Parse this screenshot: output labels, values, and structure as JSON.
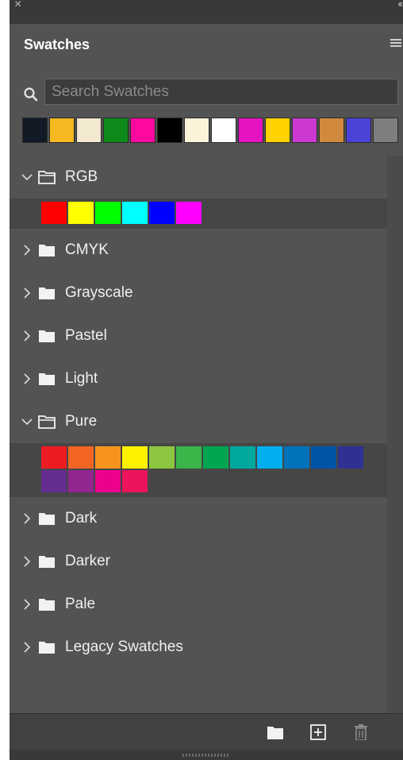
{
  "panel": {
    "tab_label": "Swatches",
    "close_icon": "close-icon",
    "collapse_icon": "collapse-icon",
    "menu_icon": "panel-menu-icon"
  },
  "search": {
    "placeholder": "Search Swatches",
    "value": ""
  },
  "recent_swatches": [
    "#121a25",
    "#f5b820",
    "#f3e8d0",
    "#0e8a1a",
    "#ff0aa0",
    "#000000",
    "#fbf3d9",
    "#ffffff",
    "#e513c1",
    "#ffd200",
    "#cc3ad3",
    "#d18a3d",
    "#4a43d8",
    "#7e7e7e"
  ],
  "groups": [
    {
      "name": "RGB",
      "expanded": true,
      "swatches": [
        "#ff0000",
        "#ffff00",
        "#00ff00",
        "#00ffff",
        "#0000ff",
        "#ff00ff"
      ]
    },
    {
      "name": "CMYK",
      "expanded": false,
      "swatches": []
    },
    {
      "name": "Grayscale",
      "expanded": false,
      "swatches": []
    },
    {
      "name": "Pastel",
      "expanded": false,
      "swatches": []
    },
    {
      "name": "Light",
      "expanded": false,
      "swatches": []
    },
    {
      "name": "Pure",
      "expanded": true,
      "swatches": [
        "#ed1c24",
        "#f26522",
        "#f7941d",
        "#fff200",
        "#8dc63f",
        "#39b54a",
        "#00a651",
        "#00a99d",
        "#00aeef",
        "#0072bc",
        "#0054a6",
        "#2e3192",
        "#662d91",
        "#92278f",
        "#ec008c",
        "#ed145b"
      ]
    },
    {
      "name": "Dark",
      "expanded": false,
      "swatches": []
    },
    {
      "name": "Darker",
      "expanded": false,
      "swatches": []
    },
    {
      "name": "Pale",
      "expanded": false,
      "swatches": []
    },
    {
      "name": "Legacy Swatches",
      "expanded": false,
      "swatches": []
    }
  ],
  "footer": {
    "new_group_icon": "new-folder-icon",
    "new_swatch_icon": "new-swatch-icon",
    "delete_icon": "trash-icon"
  },
  "colors": {
    "panel_bg": "#535353",
    "header_bg": "#393939",
    "strip_bg": "#464646"
  }
}
